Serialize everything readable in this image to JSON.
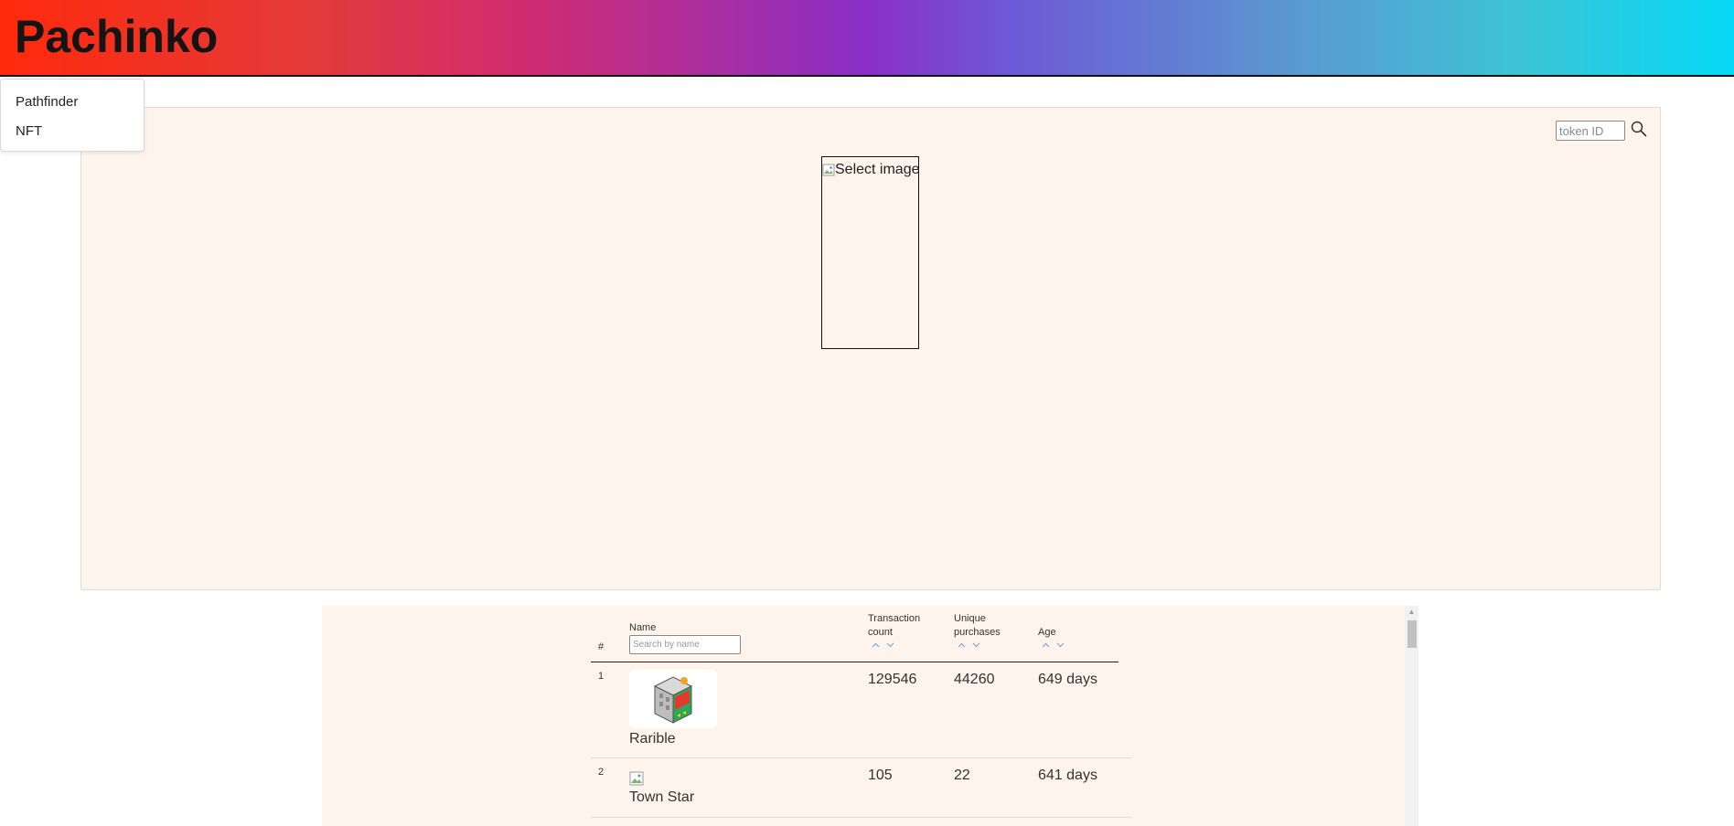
{
  "header": {
    "brand": "Pachinko"
  },
  "nav_menu": {
    "items": [
      {
        "label": "Pathfinder"
      },
      {
        "label": "NFT"
      }
    ]
  },
  "viewer": {
    "token_input_placeholder": "token ID",
    "image_alt": "Select image",
    "icons": {
      "search": "search-icon",
      "broken_image": "broken-image-icon"
    }
  },
  "table": {
    "columns": {
      "rank": "#",
      "name": "Name",
      "transaction_count_line1": "Transaction",
      "transaction_count_line2": "count",
      "unique_purchases_line1": "Unique",
      "unique_purchases_line2": "purchases",
      "age": "Age"
    },
    "name_search_placeholder": "Search by name",
    "rows": [
      {
        "rank": "1",
        "name": "Rarible",
        "transaction_count": "129546",
        "unique_purchases": "44260",
        "age": "649 days"
      },
      {
        "rank": "2",
        "name": "Town Star",
        "transaction_count": "105",
        "unique_purchases": "22",
        "age": "641 days"
      }
    ],
    "colors": {
      "sort_arrow": "#7aa7d6",
      "panel_bg": "#fef4eb"
    }
  }
}
